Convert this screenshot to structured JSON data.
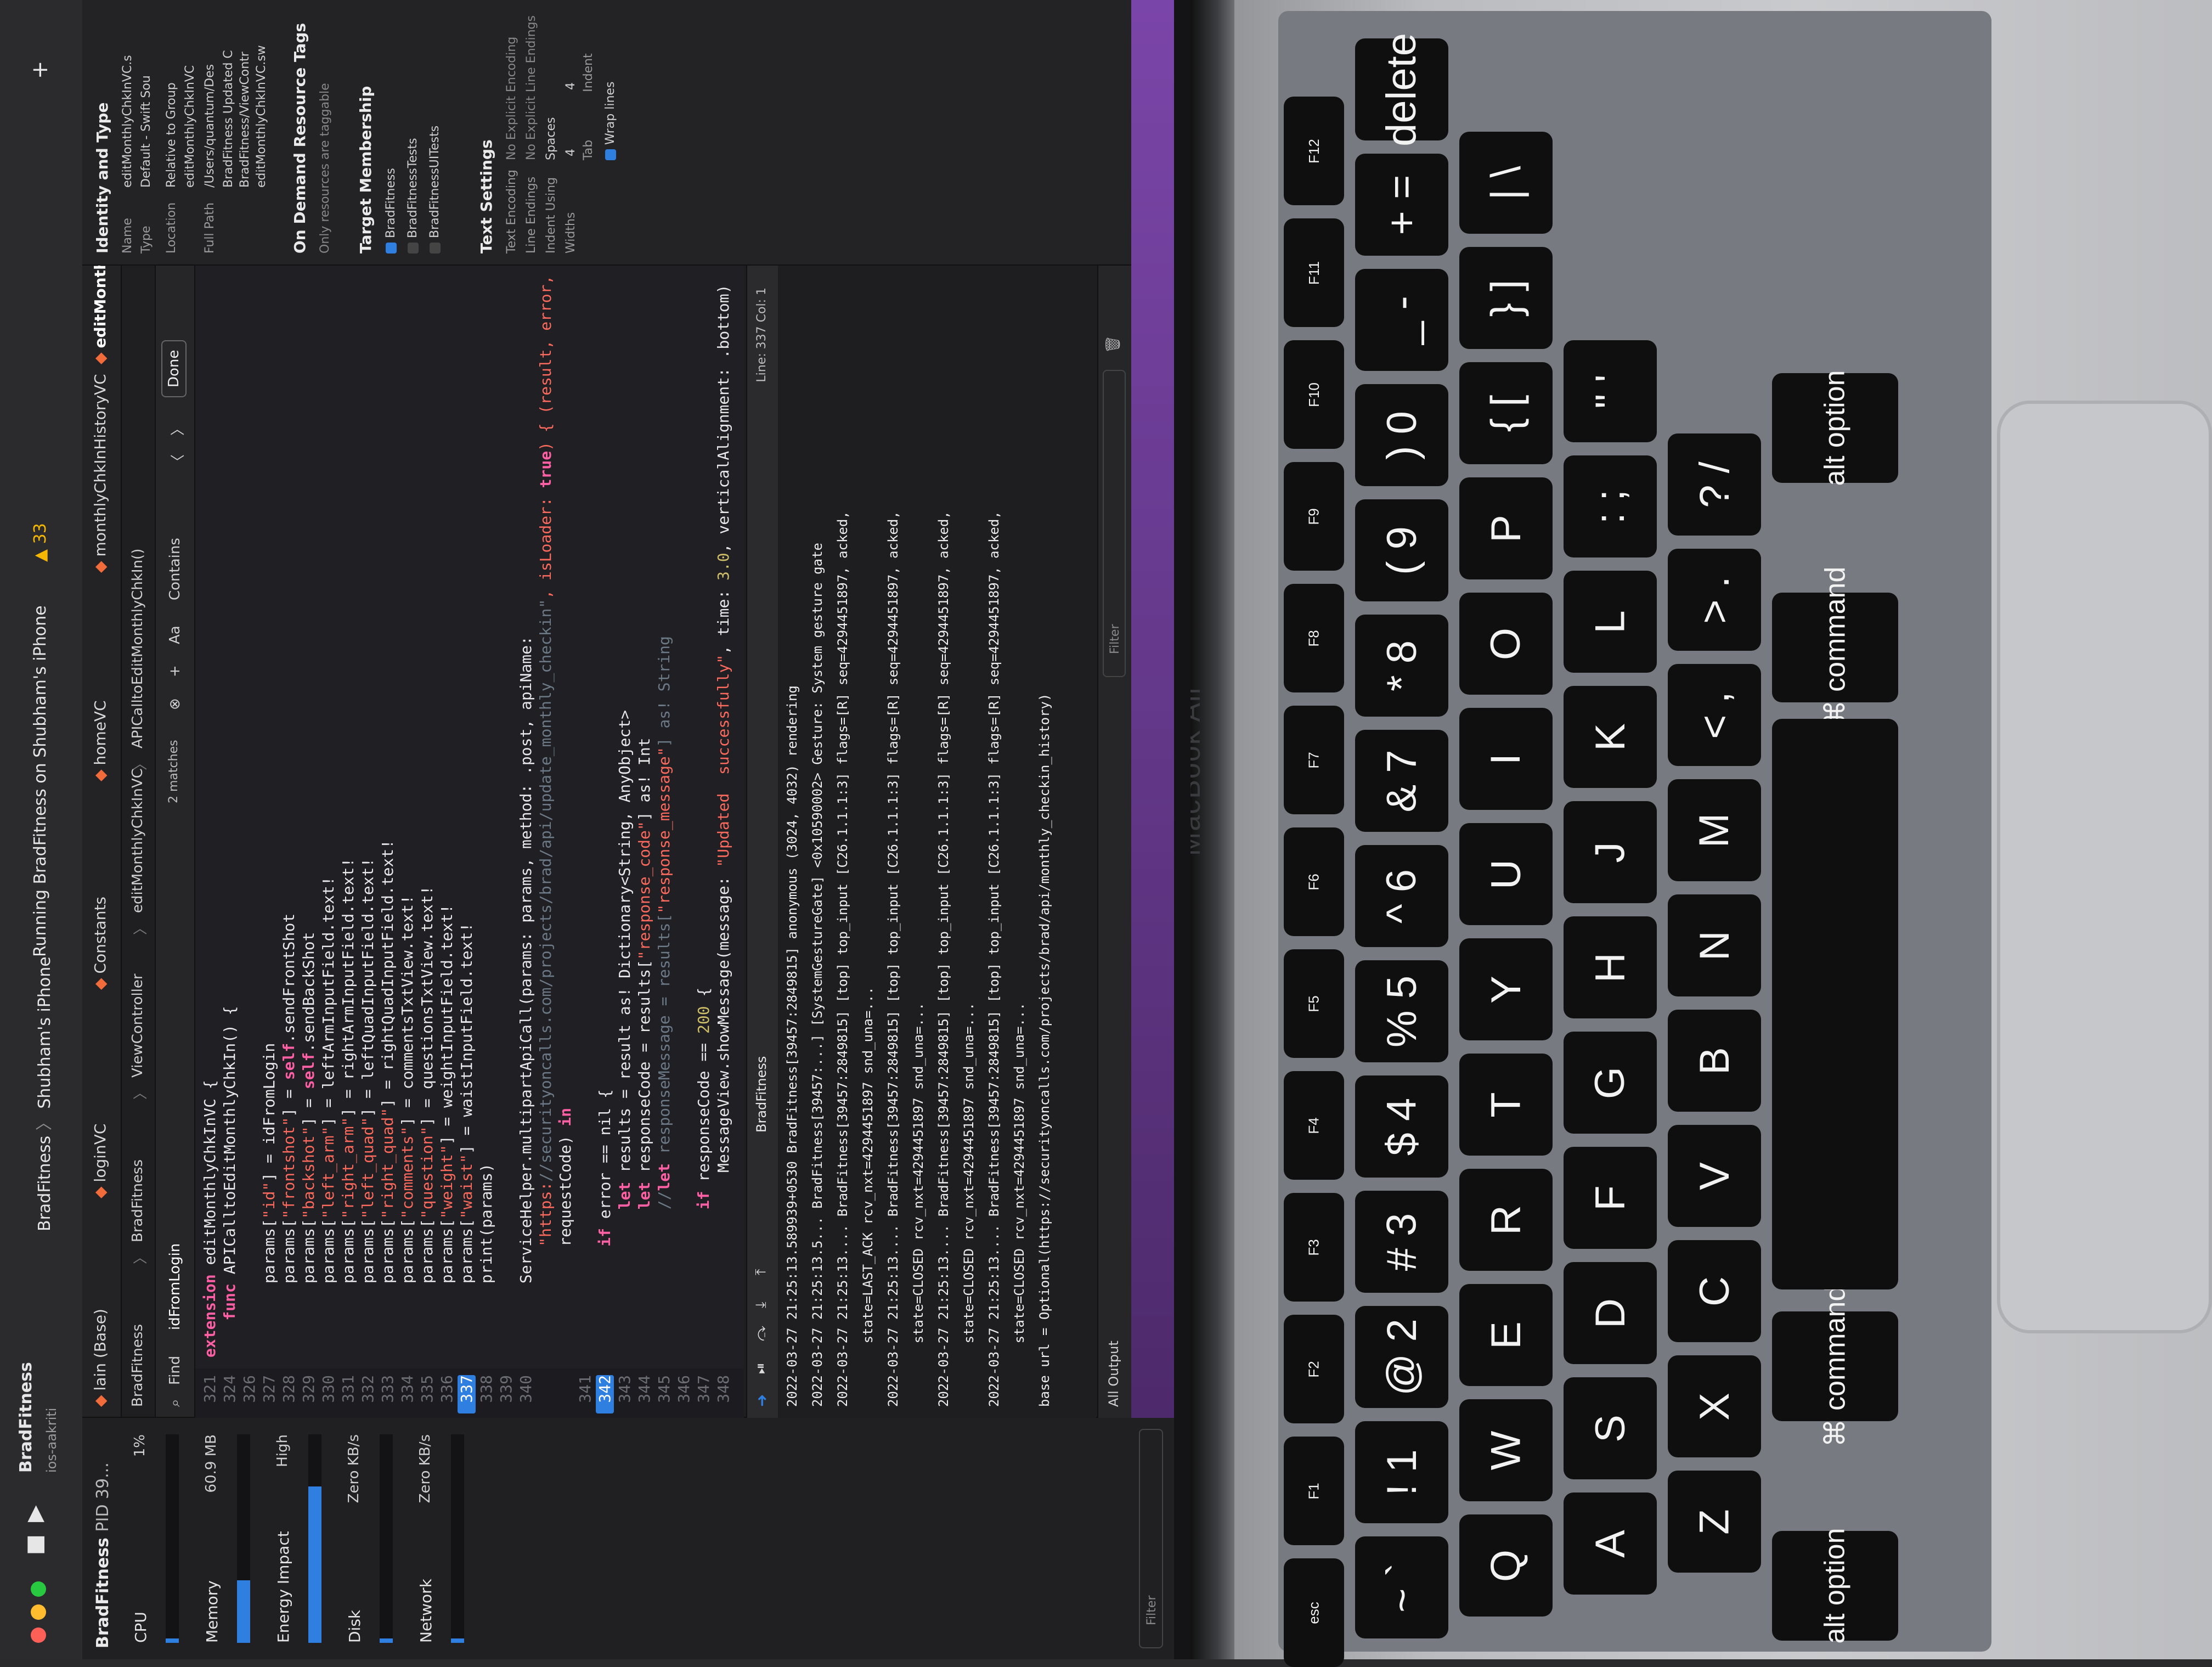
{
  "window": {
    "project_name": "BradFitness",
    "project_sub": "ios-aakriti",
    "scheme": "BradFitness",
    "device": "Shubham's iPhone",
    "status": "Running BradFitness on Shubham's iPhone",
    "warnings": "33"
  },
  "tabs": [
    "lain (Base)",
    "loginVC",
    "Constants",
    "homeVC",
    "monthlyChkInHistoryVC",
    "editMonthlyChkInVC"
  ],
  "jumpbar": {
    "path": [
      "BradFitness",
      "BradFitness",
      "ViewController",
      "editMonthlyChkInVC",
      "APICalltoEditMonthlyChkIn()"
    ]
  },
  "findbar": {
    "mode": "Find",
    "query": "idFromLogin",
    "matches": "2 matches",
    "option_aa": "Aa",
    "option_contains": "Contains",
    "done_label": "Done"
  },
  "debug_navigator": {
    "title": "BradFitness",
    "pid": "PID 39...",
    "gauges": [
      {
        "label": "CPU",
        "value": "1%",
        "fill": 0.01,
        "color": "#2f7fe0"
      },
      {
        "label": "Memory",
        "value": "60.9 MB",
        "fill": 0.3,
        "color": "#2f7fe0"
      },
      {
        "label": "Energy Impact",
        "value": "High",
        "fill": 0.75,
        "color": "#2f7fe0"
      },
      {
        "label": "Disk",
        "value": "Zero KB/s",
        "fill": 0.02,
        "color": "#2f7fe0"
      },
      {
        "label": "Network",
        "value": "Zero KB/s",
        "fill": 0.02,
        "color": "#2f7fe0"
      }
    ]
  },
  "editor": {
    "lines": [
      {
        "n": "321",
        "code": "extension editMonthlyChkInVC {",
        "bp": false
      },
      {
        "n": "324",
        "code": "    func APICalltoEditMonthlyChkIn() {",
        "bp": false
      },
      {
        "n": "326",
        "code": "",
        "bp": false
      },
      {
        "n": "327",
        "code": "        params[\"id\"] = idFromLogin",
        "bp": false
      },
      {
        "n": "328",
        "code": "        params[\"frontshot\"] = self.sendFrontShot",
        "bp": false
      },
      {
        "n": "329",
        "code": "        params[\"backshot\"] = self.sendBackShot",
        "bp": false
      },
      {
        "n": "330",
        "code": "        params[\"left_arm\"] = leftArmInputField.text!",
        "bp": false
      },
      {
        "n": "331",
        "code": "        params[\"right_arm\"] = rightArmInputField.text!",
        "bp": false
      },
      {
        "n": "332",
        "code": "        params[\"left_quad\"] = leftQuadInputField.text!",
        "bp": false
      },
      {
        "n": "333",
        "code": "        params[\"right_quad\"] = rightQuadInputField.text!",
        "bp": false
      },
      {
        "n": "334",
        "code": "        params[\"comments\"] = commentsTxtView.text!",
        "bp": false
      },
      {
        "n": "335",
        "code": "        params[\"question\"] = questionsTxtView.text!",
        "bp": false
      },
      {
        "n": "336",
        "code": "        params[\"weight\"] = weightInputField.text!",
        "bp": false
      },
      {
        "n": "337",
        "code": "        params[\"waist\"] = waistInputField.text!",
        "bp": true
      },
      {
        "n": "338",
        "code": "        print(params)",
        "bp": false
      },
      {
        "n": "339",
        "code": "",
        "bp": false
      },
      {
        "n": "340",
        "code": "        ServiceHelper.multipartApiCall(params: params, method: .post, apiName:",
        "bp": false
      },
      {
        "n": "",
        "code": "            \"https://securityoncalls.com/projects/brad/api/update_monthly_checkin\", isLoader: true) { (result, error,",
        "bp": false
      },
      {
        "n": "",
        "code": "            requestCode) in",
        "bp": false
      },
      {
        "n": "341",
        "code": "",
        "bp": false
      },
      {
        "n": "342",
        "code": "            if error == nil {",
        "bp": true
      },
      {
        "n": "343",
        "code": "                let results = result as! Dictionary<String, AnyObject>",
        "bp": false
      },
      {
        "n": "344",
        "code": "                let responseCode = results[\"response_code\"] as! Int",
        "bp": false
      },
      {
        "n": "345",
        "code": "                //let responseMessage = results[\"response_message\"] as! String",
        "bp": false
      },
      {
        "n": "346",
        "code": "",
        "bp": false
      },
      {
        "n": "347",
        "code": "                if responseCode == 200 {",
        "bp": false
      },
      {
        "n": "348",
        "code": "                    MessageView.showMessage(message: \"Updated  successfully\", time: 3.0, verticalAlignment: .bottom)",
        "bp": false
      }
    ]
  },
  "debug_area": {
    "target": "BradFitness",
    "line_col": "Line: 337  Col: 1",
    "output_label": "All Output",
    "filter_placeholder": "Filter",
    "console_lines": [
      "2022-03-27 21:25:13.589939+0530 BradFitness[39457:2849815] anonymous (3024, 4032) rendering",
      "2022-03-27 21:25:13.5... BradFitness[39457:...] [SystemGestureGate] <0x10590002> Gesture: System gesture gate",
      "2022-03-27 21:25:13.... BradFitness[39457:2849815] [top] top_input [C26.1.1.1:3] flags=[R] seq=4294451897, acked,",
      "        state=LAST_ACK rcv_nxt=4294451897 snd_una=...",
      "2022-03-27 21:25:13.... BradFitness[39457:2849815] [top] top_input [C26.1.1.1:3] flags=[R] seq=4294451897, acked,",
      "        state=CLOSED rcv_nxt=4294451897 snd_una=...",
      "2022-03-27 21:25:13.... BradFitness[39457:2849815] [top] top_input [C26.1.1.1:3] flags=[R] seq=4294451897, acked,",
      "        state=CLOSED rcv_nxt=4294451897 snd_una=...",
      "2022-03-27 21:25:13.... BradFitness[39457:2849815] [top] top_input [C26.1.1.1:3] flags=[R] seq=4294451897, acked,",
      "        state=CLOSED rcv_nxt=4294451897 snd_una=...",
      "base url = Optional(https://securityoncalls.com/projects/brad/api/monthly_checkin_history)"
    ]
  },
  "inspector": {
    "identity_title": "Identity and Type",
    "name_key": "Name",
    "name_val": "editMonthlyChkInVC.s",
    "type_key": "Type",
    "type_val": "Default - Swift Sou",
    "location_key": "Location",
    "location_val": "Relative to Group",
    "location_file": "editMonthlyChkInVC",
    "fullpath_key": "Full Path",
    "fullpath_val": "/Users/quantum/Des",
    "fullpath_rest": [
      "BradFitness Updated C",
      "BradFitness/ViewContr",
      "editMonthlyChkInVC.sw"
    ],
    "ondemand_title": "On Demand Resource Tags",
    "ondemand_note": "Only resources are taggable",
    "membership_title": "Target Membership",
    "targets": [
      {
        "name": "BradFitness",
        "checked": true
      },
      {
        "name": "BradFitnessTests",
        "checked": false
      },
      {
        "name": "BradFitnessUITests",
        "checked": false
      }
    ],
    "text_settings_title": "Text Settings",
    "text_encoding_key": "Text Encoding",
    "text_encoding_val": "No Explicit Encoding",
    "line_endings_key": "Line Endings",
    "line_endings_val": "No Explicit Line Endings",
    "indent_using_key": "Indent Using",
    "indent_using_val": "Spaces",
    "widths_key": "Widths",
    "tab_width": "4",
    "indent_width": "4",
    "tab_label": "Tab",
    "indent_label": "Indent",
    "wrap_label": "Wrap lines"
  },
  "laptop": {
    "brand": "MacBook Air",
    "keys_row_fn": [
      "esc",
      "F1",
      "F2",
      "F3",
      "F4",
      "F5",
      "F6",
      "F7",
      "F8",
      "F9",
      "F10",
      "F11",
      "F12"
    ],
    "keys_row_num": [
      "~ `",
      "! 1",
      "@ 2",
      "# 3",
      "$ 4",
      "% 5",
      "^ 6",
      "& 7",
      "* 8",
      "( 9",
      ") 0",
      "_ -",
      "+ =",
      "delete"
    ],
    "keys_row_q": [
      "Q",
      "W",
      "E",
      "R",
      "T",
      "Y",
      "U",
      "I",
      "O",
      "P",
      "{ [",
      "} ]",
      "| \\"
    ],
    "keys_row_a": [
      "A",
      "S",
      "D",
      "F",
      "G",
      "H",
      "J",
      "K",
      "L",
      ": ;",
      "\" '"
    ],
    "keys_row_z": [
      "Z",
      "X",
      "C",
      "V",
      "B",
      "N",
      "M",
      "< ,",
      "> .",
      "? /"
    ],
    "keys_row_bottom": [
      "alt option",
      "⌘ command",
      "⌘ command",
      "alt option"
    ]
  }
}
